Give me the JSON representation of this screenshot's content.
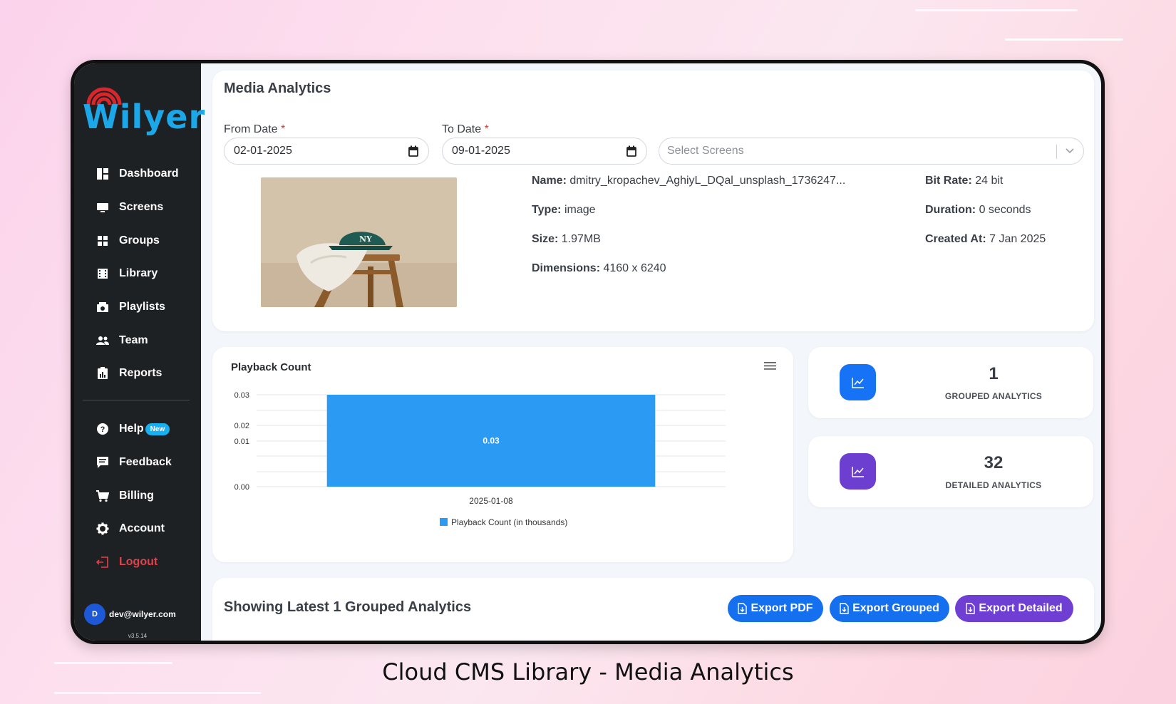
{
  "app": {
    "logo_text": "Wilyer"
  },
  "sidebar": {
    "items": [
      {
        "label": "Dashboard",
        "icon": "dashboard-icon"
      },
      {
        "label": "Screens",
        "icon": "monitor-icon"
      },
      {
        "label": "Groups",
        "icon": "grid-icon"
      },
      {
        "label": "Library",
        "icon": "film-icon"
      },
      {
        "label": "Playlists",
        "icon": "playlist-icon"
      },
      {
        "label": "Team",
        "icon": "team-icon"
      },
      {
        "label": "Reports",
        "icon": "report-icon"
      }
    ],
    "secondary": [
      {
        "label": "Help",
        "icon": "help-icon",
        "badge": "New"
      },
      {
        "label": "Feedback",
        "icon": "feedback-icon"
      },
      {
        "label": "Billing",
        "icon": "cart-icon"
      },
      {
        "label": "Account",
        "icon": "gear-icon"
      },
      {
        "label": "Logout",
        "icon": "logout-icon"
      }
    ],
    "user": {
      "initial": "D",
      "email": "dev@wilyer.com",
      "version": "v3.5.14"
    }
  },
  "media": {
    "title": "Media Analytics",
    "from_label": "From Date",
    "to_label": "To Date",
    "required_mark": "*",
    "from_value": "02-01-2025",
    "to_value": "09-01-2025",
    "screens_placeholder": "Select Screens",
    "details": {
      "name_label": "Name:",
      "name_value": "dmitry_kropachev_AghiyL_DQal_unsplash_1736247...",
      "type_label": "Type:",
      "type_value": "image",
      "size_label": "Size:",
      "size_value": "1.97MB",
      "dimensions_label": "Dimensions:",
      "dimensions_value": "4160 x 6240",
      "bitrate_label": "Bit Rate:",
      "bitrate_value": "24 bit",
      "duration_label": "Duration:",
      "duration_value": "0 seconds",
      "created_label": "Created At:",
      "created_value": "7 Jan 2025"
    }
  },
  "chart_data": {
    "type": "bar",
    "title": "Playback Count",
    "categories": [
      "2025-01-08"
    ],
    "series": [
      {
        "name": "Playback Count (in thousands)",
        "values": [
          0.03
        ],
        "color": "#2b9af3"
      }
    ],
    "yticks": [
      "0.03",
      "0.02",
      "0.01",
      "0.00"
    ],
    "ylim": [
      0,
      0.03
    ],
    "data_labels": [
      "0.03"
    ],
    "legend": "bottom",
    "grid": true
  },
  "stats": [
    {
      "value": "1",
      "label": "GROUPED ANALYTICS",
      "color": "#1773f5",
      "icon": "chart-line-icon"
    },
    {
      "value": "32",
      "label": "DETAILED ANALYTICS",
      "color": "#6c3fd1",
      "icon": "chart-line-icon"
    }
  ],
  "list": {
    "title": "Showing Latest 1 Grouped Analytics",
    "buttons": [
      {
        "label": "Export PDF",
        "color": "#1570ef"
      },
      {
        "label": "Export Grouped",
        "color": "#1570ef"
      },
      {
        "label": "Export Detailed",
        "color": "#6f3fd3"
      }
    ]
  },
  "caption": "Cloud CMS Library - Media Analytics"
}
